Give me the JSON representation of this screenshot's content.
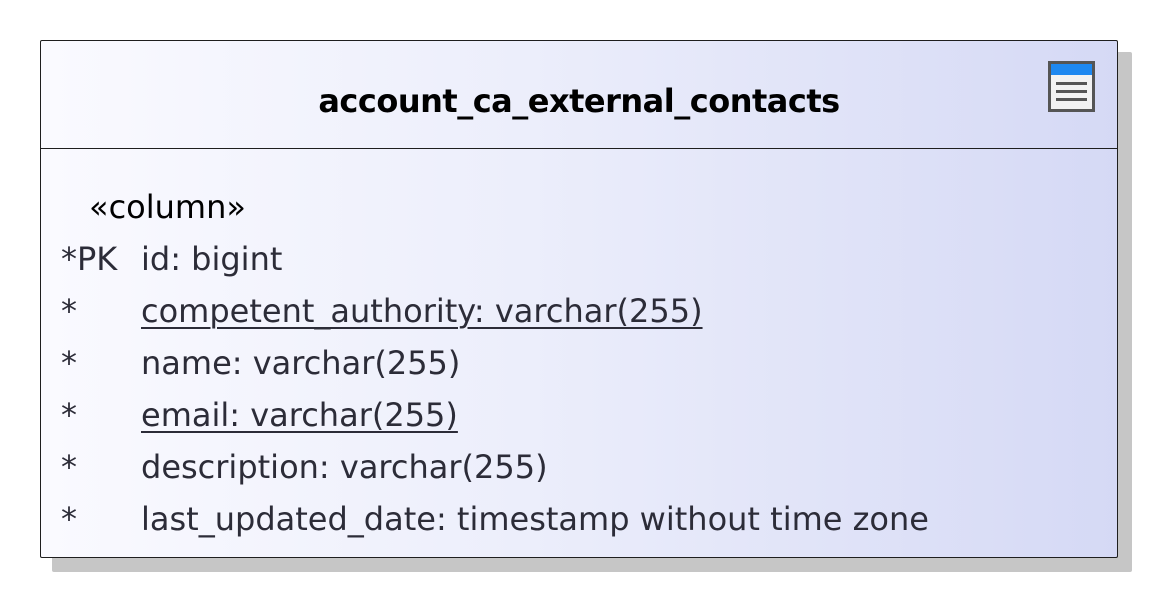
{
  "entity": {
    "name": "account_ca_external_contacts",
    "icon": "table-icon",
    "icon_colors": {
      "header": "#1e88f0",
      "frame": "#555555"
    },
    "stereotype": "«column»",
    "columns": [
      {
        "marker": "*PK",
        "text": "id: bigint",
        "underlined": false
      },
      {
        "marker": "*",
        "text": "competent_authority: varchar(255)",
        "underlined": true
      },
      {
        "marker": "*",
        "text": "name: varchar(255)",
        "underlined": false
      },
      {
        "marker": "*",
        "text": "email: varchar(255)",
        "underlined": true
      },
      {
        "marker": "*",
        "text": "description: varchar(255)",
        "underlined": false
      },
      {
        "marker": "*",
        "text": "last_updated_date: timestamp without time zone",
        "underlined": false
      }
    ]
  }
}
